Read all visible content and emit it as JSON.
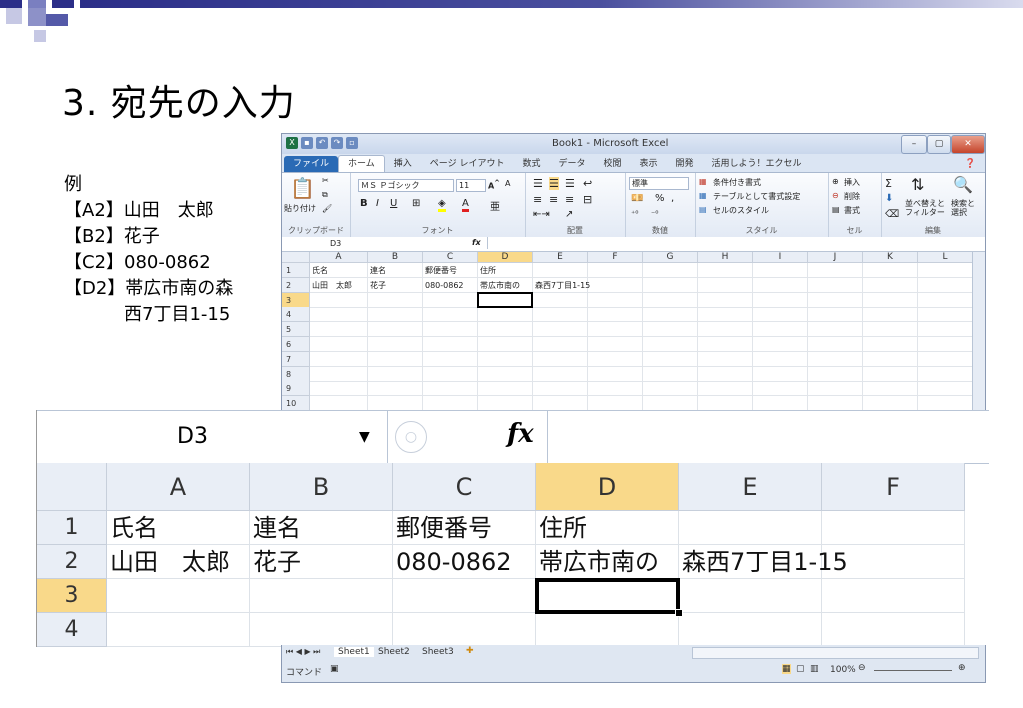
{
  "slide": {
    "title": "3. 宛先の入力",
    "example_heading": "例",
    "example_lines": [
      "【A2】山田　太郎",
      "【B2】花子",
      "【C2】080-0862",
      "【D2】帯広市南の森"
    ],
    "example_continuation": "西7丁目1-15"
  },
  "window": {
    "title": "Book1 - Microsoft Excel",
    "tabs": [
      "ファイル",
      "ホーム",
      "挿入",
      "ページ レイアウト",
      "数式",
      "データ",
      "校閲",
      "表示",
      "開発",
      "活用しよう！エクセル"
    ],
    "active_tab": "ホーム"
  },
  "ribbon": {
    "paste": "貼り付け",
    "font_name": "ＭＳ Ｐゴシック",
    "font_size": "11",
    "number_format": "標準",
    "conditional": "条件付き書式",
    "as_table": "テーブルとして書式設定",
    "cell_styles": "セルのスタイル",
    "insert": "挿入",
    "delete": "削除",
    "format": "書式",
    "sort_filter": "並べ替えと\nフィルター",
    "find_select": "検索と\n選択",
    "groups": [
      "クリップボード",
      "フォント",
      "配置",
      "数値",
      "スタイル",
      "セル",
      "編集"
    ]
  },
  "formula_bar": {
    "name_box": "D3",
    "fx": "fx"
  },
  "columns": [
    "A",
    "B",
    "C",
    "D",
    "E",
    "F",
    "G",
    "H",
    "I",
    "J",
    "K",
    "L"
  ],
  "rows": [
    "1",
    "2",
    "3",
    "4",
    "5",
    "6",
    "7",
    "8",
    "9",
    "10"
  ],
  "cells": {
    "A1": "氏名",
    "B1": "連名",
    "C1": "郵便番号",
    "D1": "住所",
    "A2": "山田　太郎",
    "B2": "花子",
    "C2": "080-0862",
    "D2": "帯広市南の",
    "E2": "森西7丁目1-15"
  },
  "sheets": [
    "Sheet1",
    "Sheet2",
    "Sheet3"
  ],
  "status": {
    "mode": "コマンド",
    "zoom": "100%"
  },
  "colors": {
    "selected_header": "#f9d98a",
    "accent": "#2a6ab5",
    "selection_border": "#000000"
  }
}
